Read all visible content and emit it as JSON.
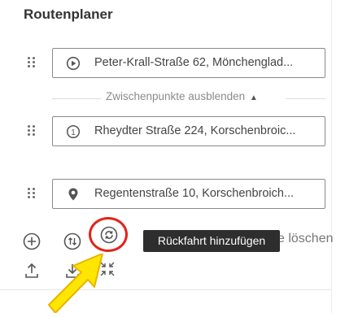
{
  "panel": {
    "title": "Routenplaner"
  },
  "route": {
    "stops": [
      {
        "icon": "start-marker-icon",
        "address": "Peter-Krall-Straße 62, Mönchenglad..."
      },
      {
        "icon": "waypoint-number-icon",
        "number": "1",
        "address": "Rheydter Straße 224, Korschenbroic..."
      },
      {
        "icon": "destination-pin-icon",
        "address": "Regentenstraße 10, Korschenbroich..."
      }
    ],
    "toggle_waypoints_label": "Zwischenpunkte ausblenden",
    "toggle_waypoints_arrow": "▲"
  },
  "toolbar": {
    "tooltip": "Rückfahrt hinzufügen",
    "delete_partial_label": "e löschen"
  },
  "colors": {
    "highlight_circle": "#e2231a",
    "arrow_fill": "#ffe600",
    "tooltip_bg": "#2e2e2e"
  }
}
